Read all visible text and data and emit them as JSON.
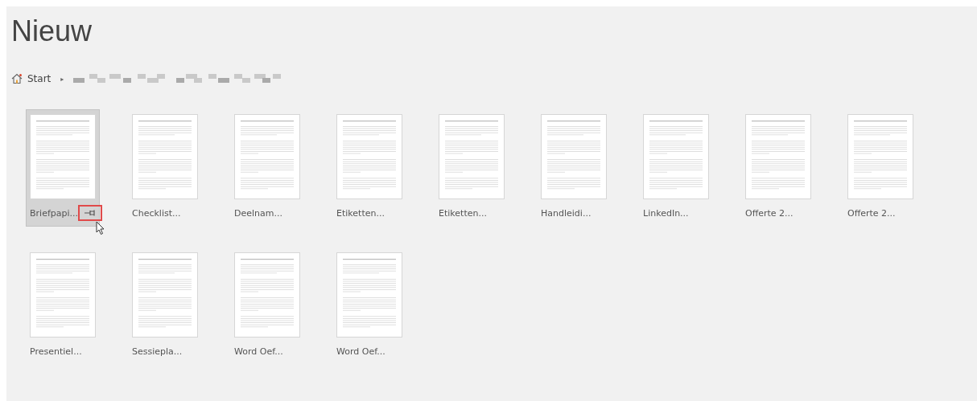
{
  "title": "Nieuw",
  "breadcrumb": {
    "home": "Start",
    "separator": "▸"
  },
  "templates": [
    {
      "label": "Briefpapi...",
      "selected": true
    },
    {
      "label": "Checklist...",
      "selected": false
    },
    {
      "label": "Deelnam...",
      "selected": false
    },
    {
      "label": "Etiketten...",
      "selected": false
    },
    {
      "label": "Etiketten...",
      "selected": false
    },
    {
      "label": "Handleidi...",
      "selected": false
    },
    {
      "label": "LinkedIn...",
      "selected": false
    },
    {
      "label": "Offerte 2...",
      "selected": false
    },
    {
      "label": "Offerte 2...",
      "selected": false
    },
    {
      "label": "Presentiel...",
      "selected": false
    },
    {
      "label": "Sessiepla...",
      "selected": false
    },
    {
      "label": "Word Oef...",
      "selected": false
    },
    {
      "label": "Word Oef...",
      "selected": false
    }
  ]
}
